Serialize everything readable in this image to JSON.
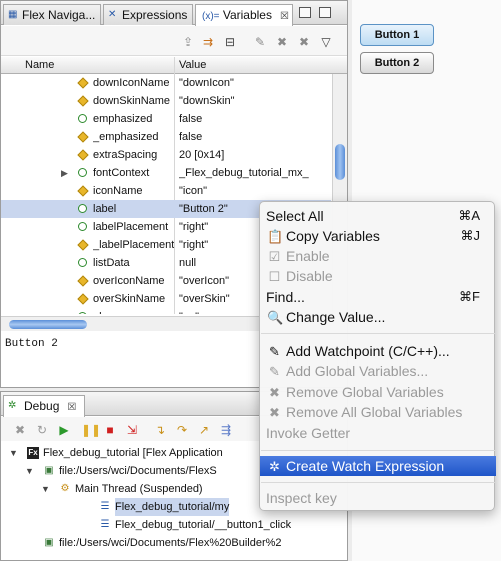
{
  "tabs": {
    "nav": "Flex Naviga...",
    "expressions": "Expressions",
    "variables": "Variables",
    "variables_prefix": "(x)="
  },
  "columns": {
    "name": "Name",
    "value": "Value"
  },
  "variables": [
    {
      "name": "downIconName",
      "value": "\"downIcon\"",
      "icon": "diamond"
    },
    {
      "name": "downSkinName",
      "value": "\"downSkin\"",
      "icon": "diamond"
    },
    {
      "name": "emphasized",
      "value": "false",
      "icon": "getter"
    },
    {
      "name": "_emphasized",
      "value": "false",
      "icon": "diamond"
    },
    {
      "name": "extraSpacing",
      "value": "20 [0x14]",
      "icon": "diamond"
    },
    {
      "name": "fontContext",
      "value": "_Flex_debug_tutorial_mx_",
      "icon": "getter",
      "expandable": true
    },
    {
      "name": "iconName",
      "value": "\"icon\"",
      "icon": "diamond"
    },
    {
      "name": "label",
      "value": "\"Button 2\"",
      "icon": "getter",
      "selected": true
    },
    {
      "name": "labelPlacement",
      "value": "\"right\"",
      "icon": "getter"
    },
    {
      "name": "_labelPlacement",
      "value": "\"right\"",
      "icon": "diamond"
    },
    {
      "name": "listData",
      "value": "null",
      "icon": "getter"
    },
    {
      "name": "overIconName",
      "value": "\"overIcon\"",
      "icon": "diamond"
    },
    {
      "name": "overSkinName",
      "value": "\"overSkin\"",
      "icon": "diamond"
    },
    {
      "name": "phase",
      "value": "\"up\"",
      "icon": "getter"
    }
  ],
  "detail_text": "Button 2",
  "debug": {
    "tab_label": "Debug",
    "tree": [
      {
        "label": "Flex_debug_tutorial [Flex Application",
        "icon": "Fx"
      },
      {
        "label": "file:/Users/wci/Documents/FlexS",
        "icon": "app"
      },
      {
        "label": "Main Thread (Suspended)",
        "icon": "thread"
      },
      {
        "label": "Flex_debug_tutorial/my",
        "icon": "frame",
        "selected": true
      },
      {
        "label": "Flex_debug_tutorial/__button1_click",
        "icon": "frame"
      },
      {
        "label": "file:/Users/wci/Documents/Flex%20Builder%2",
        "icon": "app"
      }
    ]
  },
  "app_buttons": {
    "button1": "Button 1",
    "button2": "Button 2"
  },
  "context_menu": {
    "select_all": "Select All",
    "select_all_key": "⌘A",
    "copy_variables": "Copy Variables",
    "copy_variables_key": "⌘J",
    "enable": "Enable",
    "disable": "Disable",
    "find": "Find...",
    "find_key": "⌘F",
    "change_value": "Change Value...",
    "add_watchpoint": "Add Watchpoint (C/C++)...",
    "add_global_variables": "Add Global Variables...",
    "remove_global_variables": "Remove Global Variables",
    "remove_all_global_variables": "Remove All Global Variables",
    "invoke_getter": "Invoke Getter",
    "create_watch_expression": "Create Watch Expression",
    "inspect_key": "Inspect key"
  },
  "colors": {
    "selection": "#c9d6ee",
    "menu_highlight": "#2a5fd0",
    "thumb": "#5b8fd8"
  }
}
